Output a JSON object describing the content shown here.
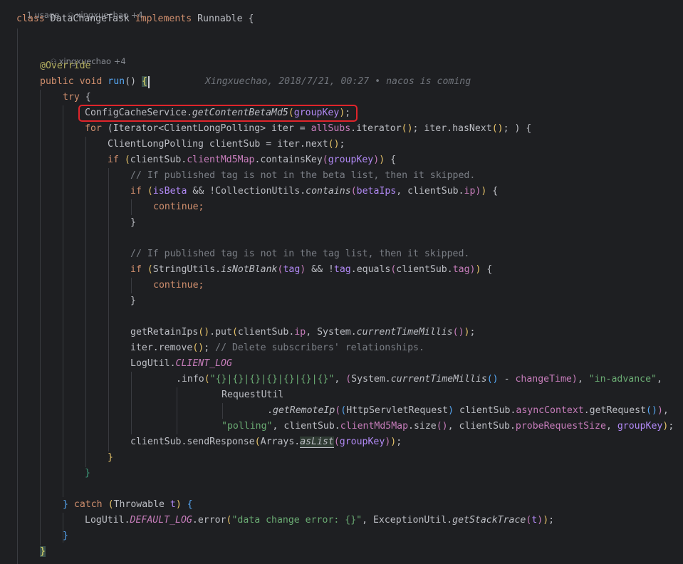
{
  "inlays": {
    "top": "1 usage   • xingxuechao +4",
    "usage": "1 usage",
    "top_author": "xingxuechao +4",
    "method_author": "xingxuechao +4"
  },
  "blame": "Xingxuechao, 2018/7/21, 00:27 • nacos is coming",
  "colors": {
    "background": "#1e1f22",
    "keyword": "#cf8e6d",
    "string": "#6aab73",
    "comment": "#7a7e85",
    "field": "#c77dbb",
    "annotation": "#b3ae60",
    "highlight_box": "#e0242b"
  },
  "code": {
    "l1": "class DataChangeTask implements Runnable {",
    "l2": "@Override",
    "l3": "public void run() {",
    "l4": "try {",
    "l5": "ConfigCacheService.getContentBetaMd5(groupKey);",
    "l6": "for (Iterator<ClientLongPolling> iter = allSubs.iterator(); iter.hasNext(); ) {",
    "l7": "ClientLongPolling clientSub = iter.next();",
    "l8": "if (clientSub.clientMd5Map.containsKey(groupKey)) {",
    "l9": "// If published tag is not in the beta list, then it skipped.",
    "l10": "if (isBeta && !CollectionUtils.contains(betaIps, clientSub.ip)) {",
    "l11": "continue;",
    "l12": "}",
    "l13": "// If published tag is not in the tag list, then it skipped.",
    "l14": "if (StringUtils.isNotBlank(tag) && !tag.equals(clientSub.tag)) {",
    "l15": "continue;",
    "l16": "}",
    "l17": "getRetainIps().put(clientSub.ip, System.currentTimeMillis());",
    "l18": "iter.remove(); // Delete subscribers' relationships.",
    "l19": "LogUtil.CLIENT_LOG",
    "l20": ".info(\"{}|{}|{}|{}|{}|{}|{}\", (System.currentTimeMillis() - changeTime), \"in-advance\",",
    "l21": "RequestUtil",
    "l22": ".getRemoteIp((HttpServletRequest) clientSub.asyncContext.getRequest()),",
    "l23": "\"polling\", clientSub.clientMd5Map.size(), clientSub.probeRequestSize, groupKey);",
    "l24": "clientSub.sendResponse(Arrays.asList(groupKey));",
    "l25": "}",
    "l26": "}",
    "l27": "} catch (Throwable t) {",
    "l28": "LogUtil.DEFAULT_LOG.error(\"data change error: {}\", ExceptionUtil.getStackTrace(t));",
    "l29": "}",
    "l30": "}"
  }
}
